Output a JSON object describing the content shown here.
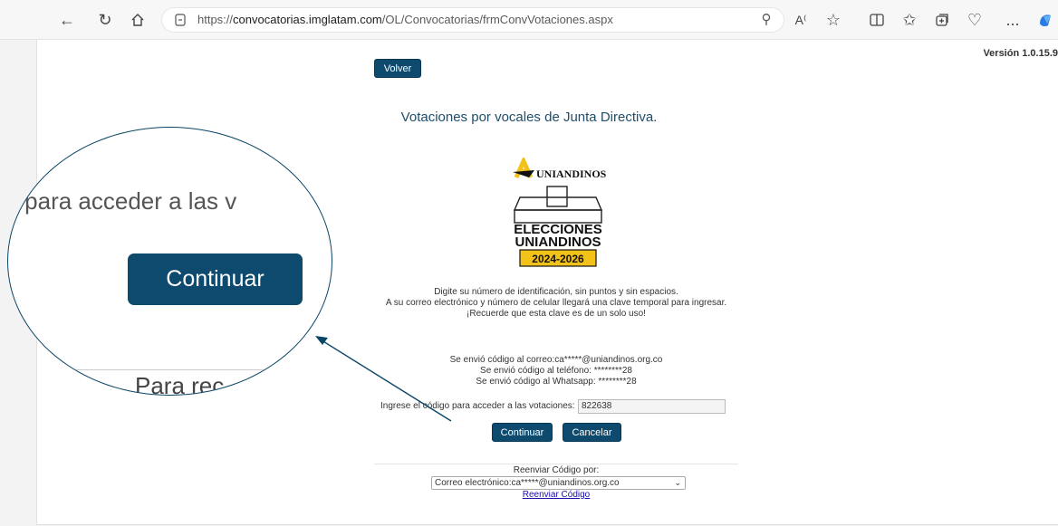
{
  "browser": {
    "url_prefix": "https://",
    "url_host": "convocatorias.imglatam.com",
    "url_path": "/OL/Convocatorias/frmConvVotaciones.aspx",
    "toolbar_more": "..."
  },
  "page": {
    "version": "Versión 1.0.15.9",
    "back_label": "Volver",
    "title": "Votaciones por vocales de Junta Directiva.",
    "logo": {
      "brand": "UNIANDINOS",
      "line1": "ELECCIONES",
      "line2": "UNIANDINOS",
      "years": "2024-2026"
    },
    "instructions": [
      "Digite su número de identificación, sin puntos y sin espacios.",
      "A su correo electrónico y número de celular llegará una clave temporal para ingresar.",
      "¡Recuerde que esta clave es de un solo uso!"
    ],
    "sent_notices": [
      "Se envió código al correo:ca*****@uniandinos.org.co",
      "Se envió código al teléfono: ********28",
      "Se envió código al Whatsapp: ********28"
    ],
    "code_label": "Ingrese el código para acceder a las votaciones:",
    "code_value": "822638",
    "continue_label": "Continuar",
    "cancel_label": "Cancelar",
    "resend_label": "Reenviar Código por:",
    "resend_selected": "Correo electrónico:ca*****@uniandinos.org.co",
    "resend_link": "Reenviar Código"
  },
  "magnifier": {
    "text_top": "go para acceder a las v",
    "button_label": "Continuar",
    "text_bottom": "Para rec"
  },
  "colors": {
    "primary": "#0d4a6e",
    "logo_yellow": "#f2c21b",
    "link": "#1a0dab"
  }
}
